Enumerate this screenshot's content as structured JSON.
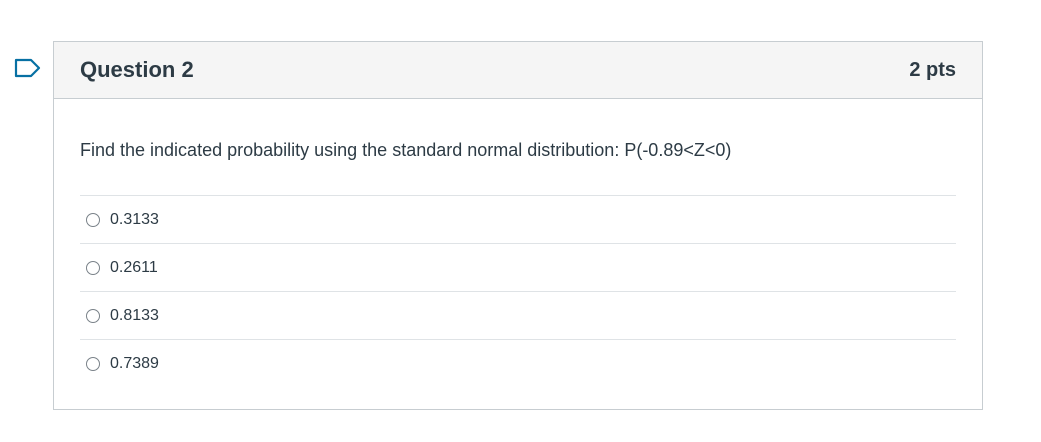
{
  "question": {
    "title": "Question 2",
    "points": "2 pts",
    "text": "Find the indicated probability using the standard normal distribution: P(-0.89<Z<0)",
    "flag_icon": "bookmark-flag-icon",
    "answers": [
      {
        "label": "0.3133",
        "selected": false
      },
      {
        "label": "0.2611",
        "selected": false
      },
      {
        "label": "0.8133",
        "selected": false
      },
      {
        "label": "0.7389",
        "selected": false
      }
    ]
  },
  "colors": {
    "header_bg": "#f5f5f5",
    "border": "#c7cdd1",
    "text": "#2d3b45",
    "flag": "#0770a3"
  }
}
